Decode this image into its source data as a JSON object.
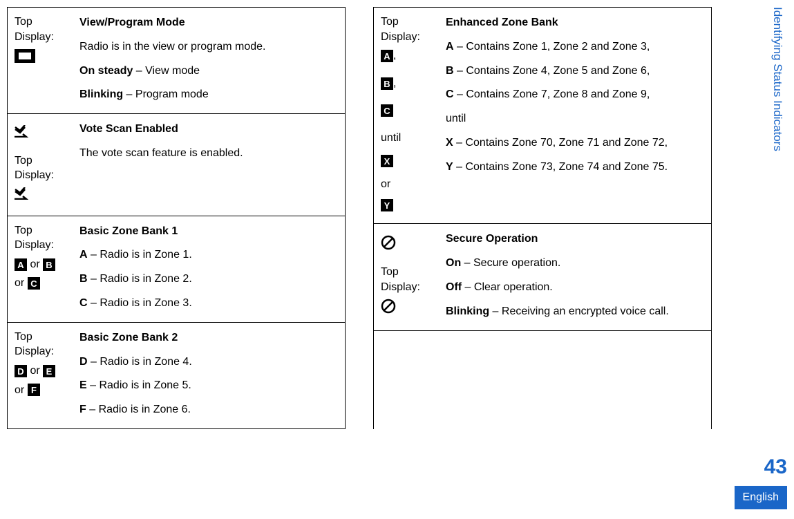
{
  "side": {
    "title": "Identifying Status Indicators",
    "page": "43",
    "lang": "English"
  },
  "col1": {
    "r1": {
      "label": "Top Display:",
      "title": "View/Program Mode",
      "line1": "Radio is in the view or program mode.",
      "l2a": "On steady",
      "l2b": " – View mode",
      "l3a": "Blinking",
      "l3b": " – Program mode"
    },
    "r2": {
      "label": "Top Display:",
      "title": "Vote Scan Enabled",
      "line1": "The vote scan feature is enabled."
    },
    "r3": {
      "label": "Top Display:",
      "or1": " or ",
      "or2": "or ",
      "title": "Basic Zone Bank 1",
      "a1": "A",
      "a2": " – Radio is in Zone 1.",
      "b1": "B",
      "b2": " – Radio is in Zone 2.",
      "c1": "C",
      "c2": " – Radio is in Zone 3."
    },
    "r4": {
      "label": "Top Display:",
      "or1": " or ",
      "or2": "or ",
      "title": "Basic Zone Bank 2",
      "d1": "D",
      "d2": " – Radio is in Zone 4.",
      "e1": "E",
      "e2": " – Radio is in Zone 5.",
      "f1": "F",
      "f2": " – Radio is in Zone 6."
    }
  },
  "col2": {
    "r1": {
      "label": "Top Display:",
      "until": "until",
      "or": "or",
      "title": "Enhanced Zone Bank",
      "a1": "A",
      "a2": " – Contains Zone 1, Zone 2 and Zone 3,",
      "b1": "B",
      "b2": " – Contains Zone 4, Zone 5 and Zone 6,",
      "c1": "C",
      "c2": " – Contains Zone 7, Zone 8 and Zone 9,",
      "u": "until",
      "x1": "X",
      "x2": " – Contains Zone 70, Zone 71 and Zone 72,",
      "y1": "Y",
      "y2": " – Contains Zone 73, Zone 74 and Zone 75."
    },
    "r2": {
      "label": "Top Display:",
      "title": "Secure Operation",
      "on1": "On",
      "on2": " – Secure operation.",
      "off1": "Off",
      "off2": " – Clear operation.",
      "bl1": "Blinking",
      "bl2": " – Receiving an encrypted voice call."
    }
  }
}
